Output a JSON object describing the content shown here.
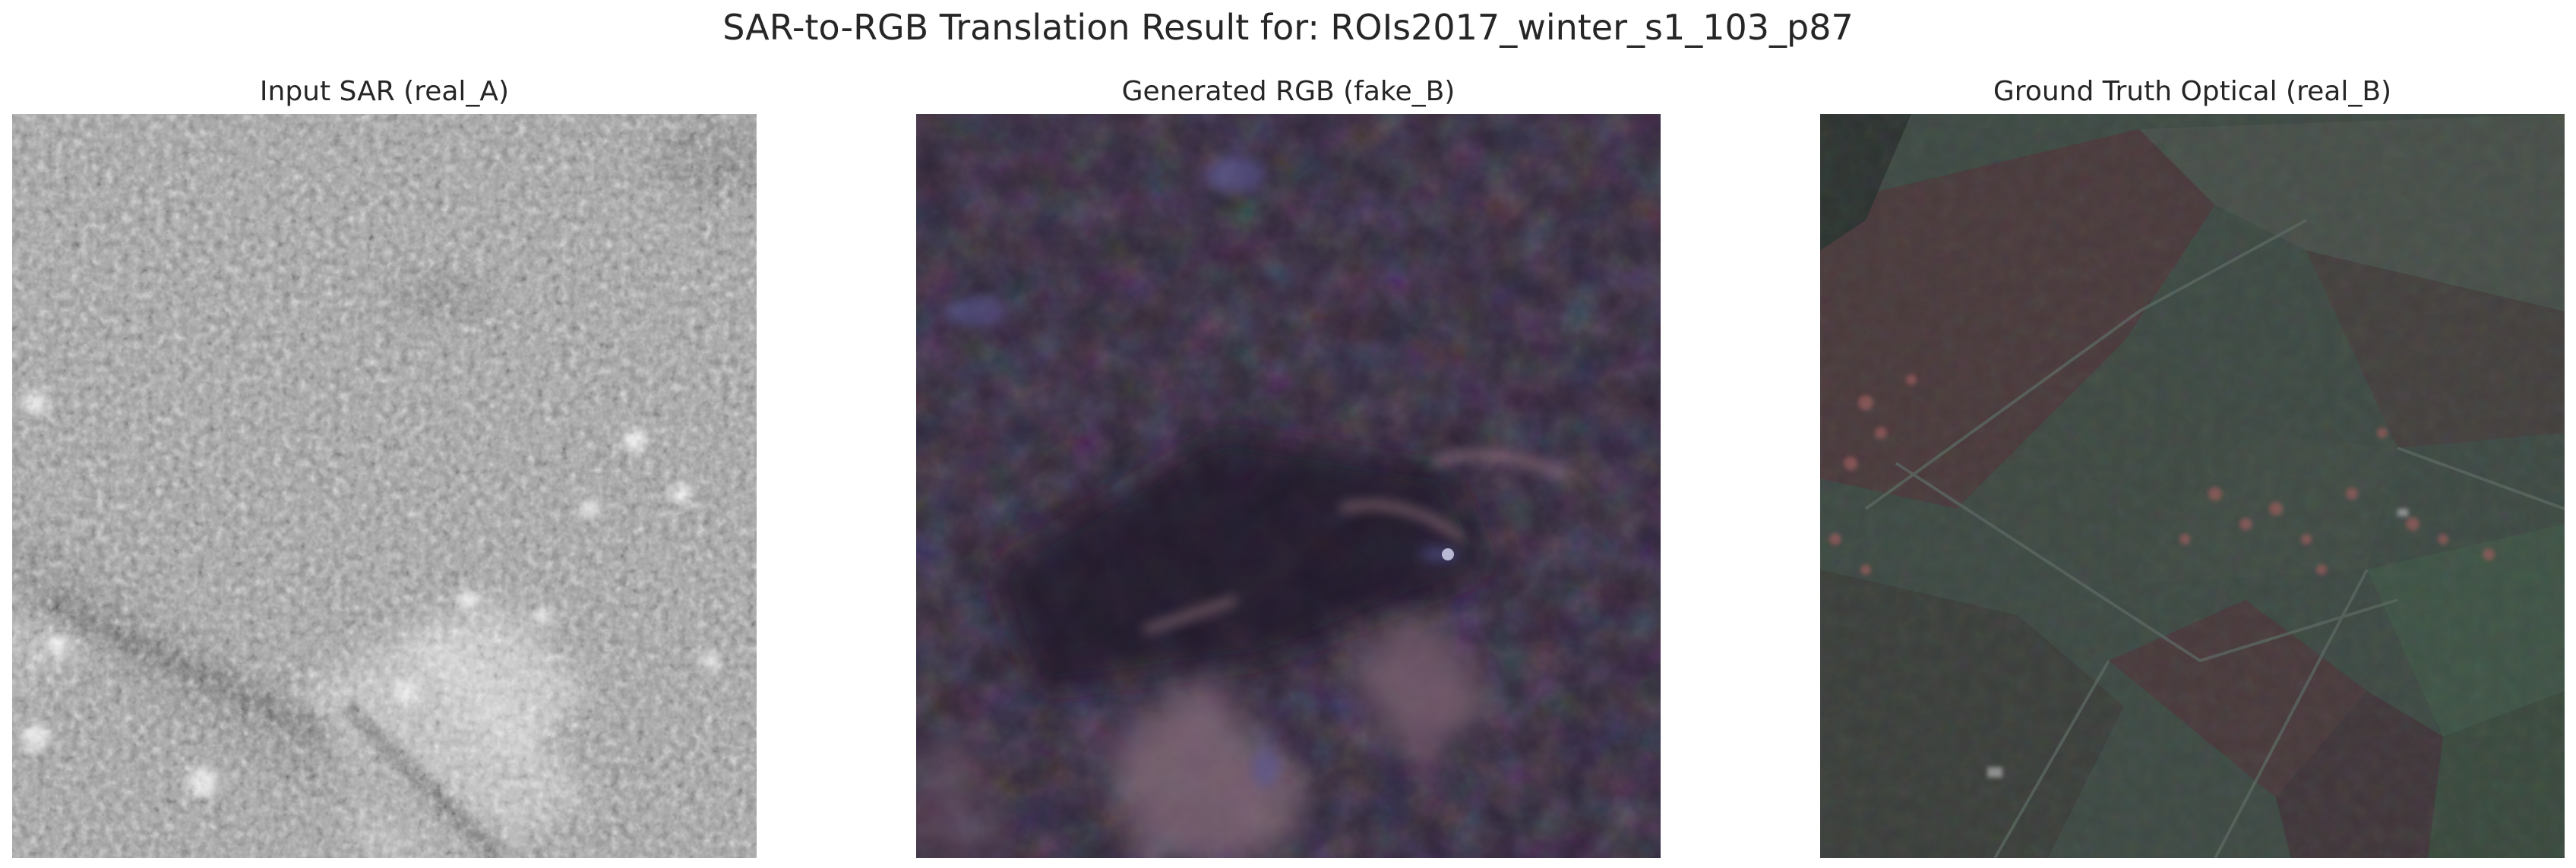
{
  "figure": {
    "title": "SAR-to-RGB Translation Result for: ROIs2017_winter_s1_103_p87"
  },
  "panels": [
    {
      "title": "Input SAR (real_A)",
      "image_description_colors": {
        "base": "#9a9a9a",
        "dark": "#5c5c5c",
        "bright": "#e8e8e8"
      }
    },
    {
      "title": "Generated RGB (fake_B)",
      "image_description_colors": {
        "base": "#2e2538",
        "dark": "#1c1826",
        "bright": "#8a6f7e",
        "accent": "#5a5a9a"
      }
    },
    {
      "title": "Ground Truth Optical (real_B)",
      "image_description_colors": {
        "base": "#3e4a44",
        "field": "#4a3a3c",
        "green": "#3f5446",
        "roof": "#9a5a5a"
      }
    }
  ]
}
